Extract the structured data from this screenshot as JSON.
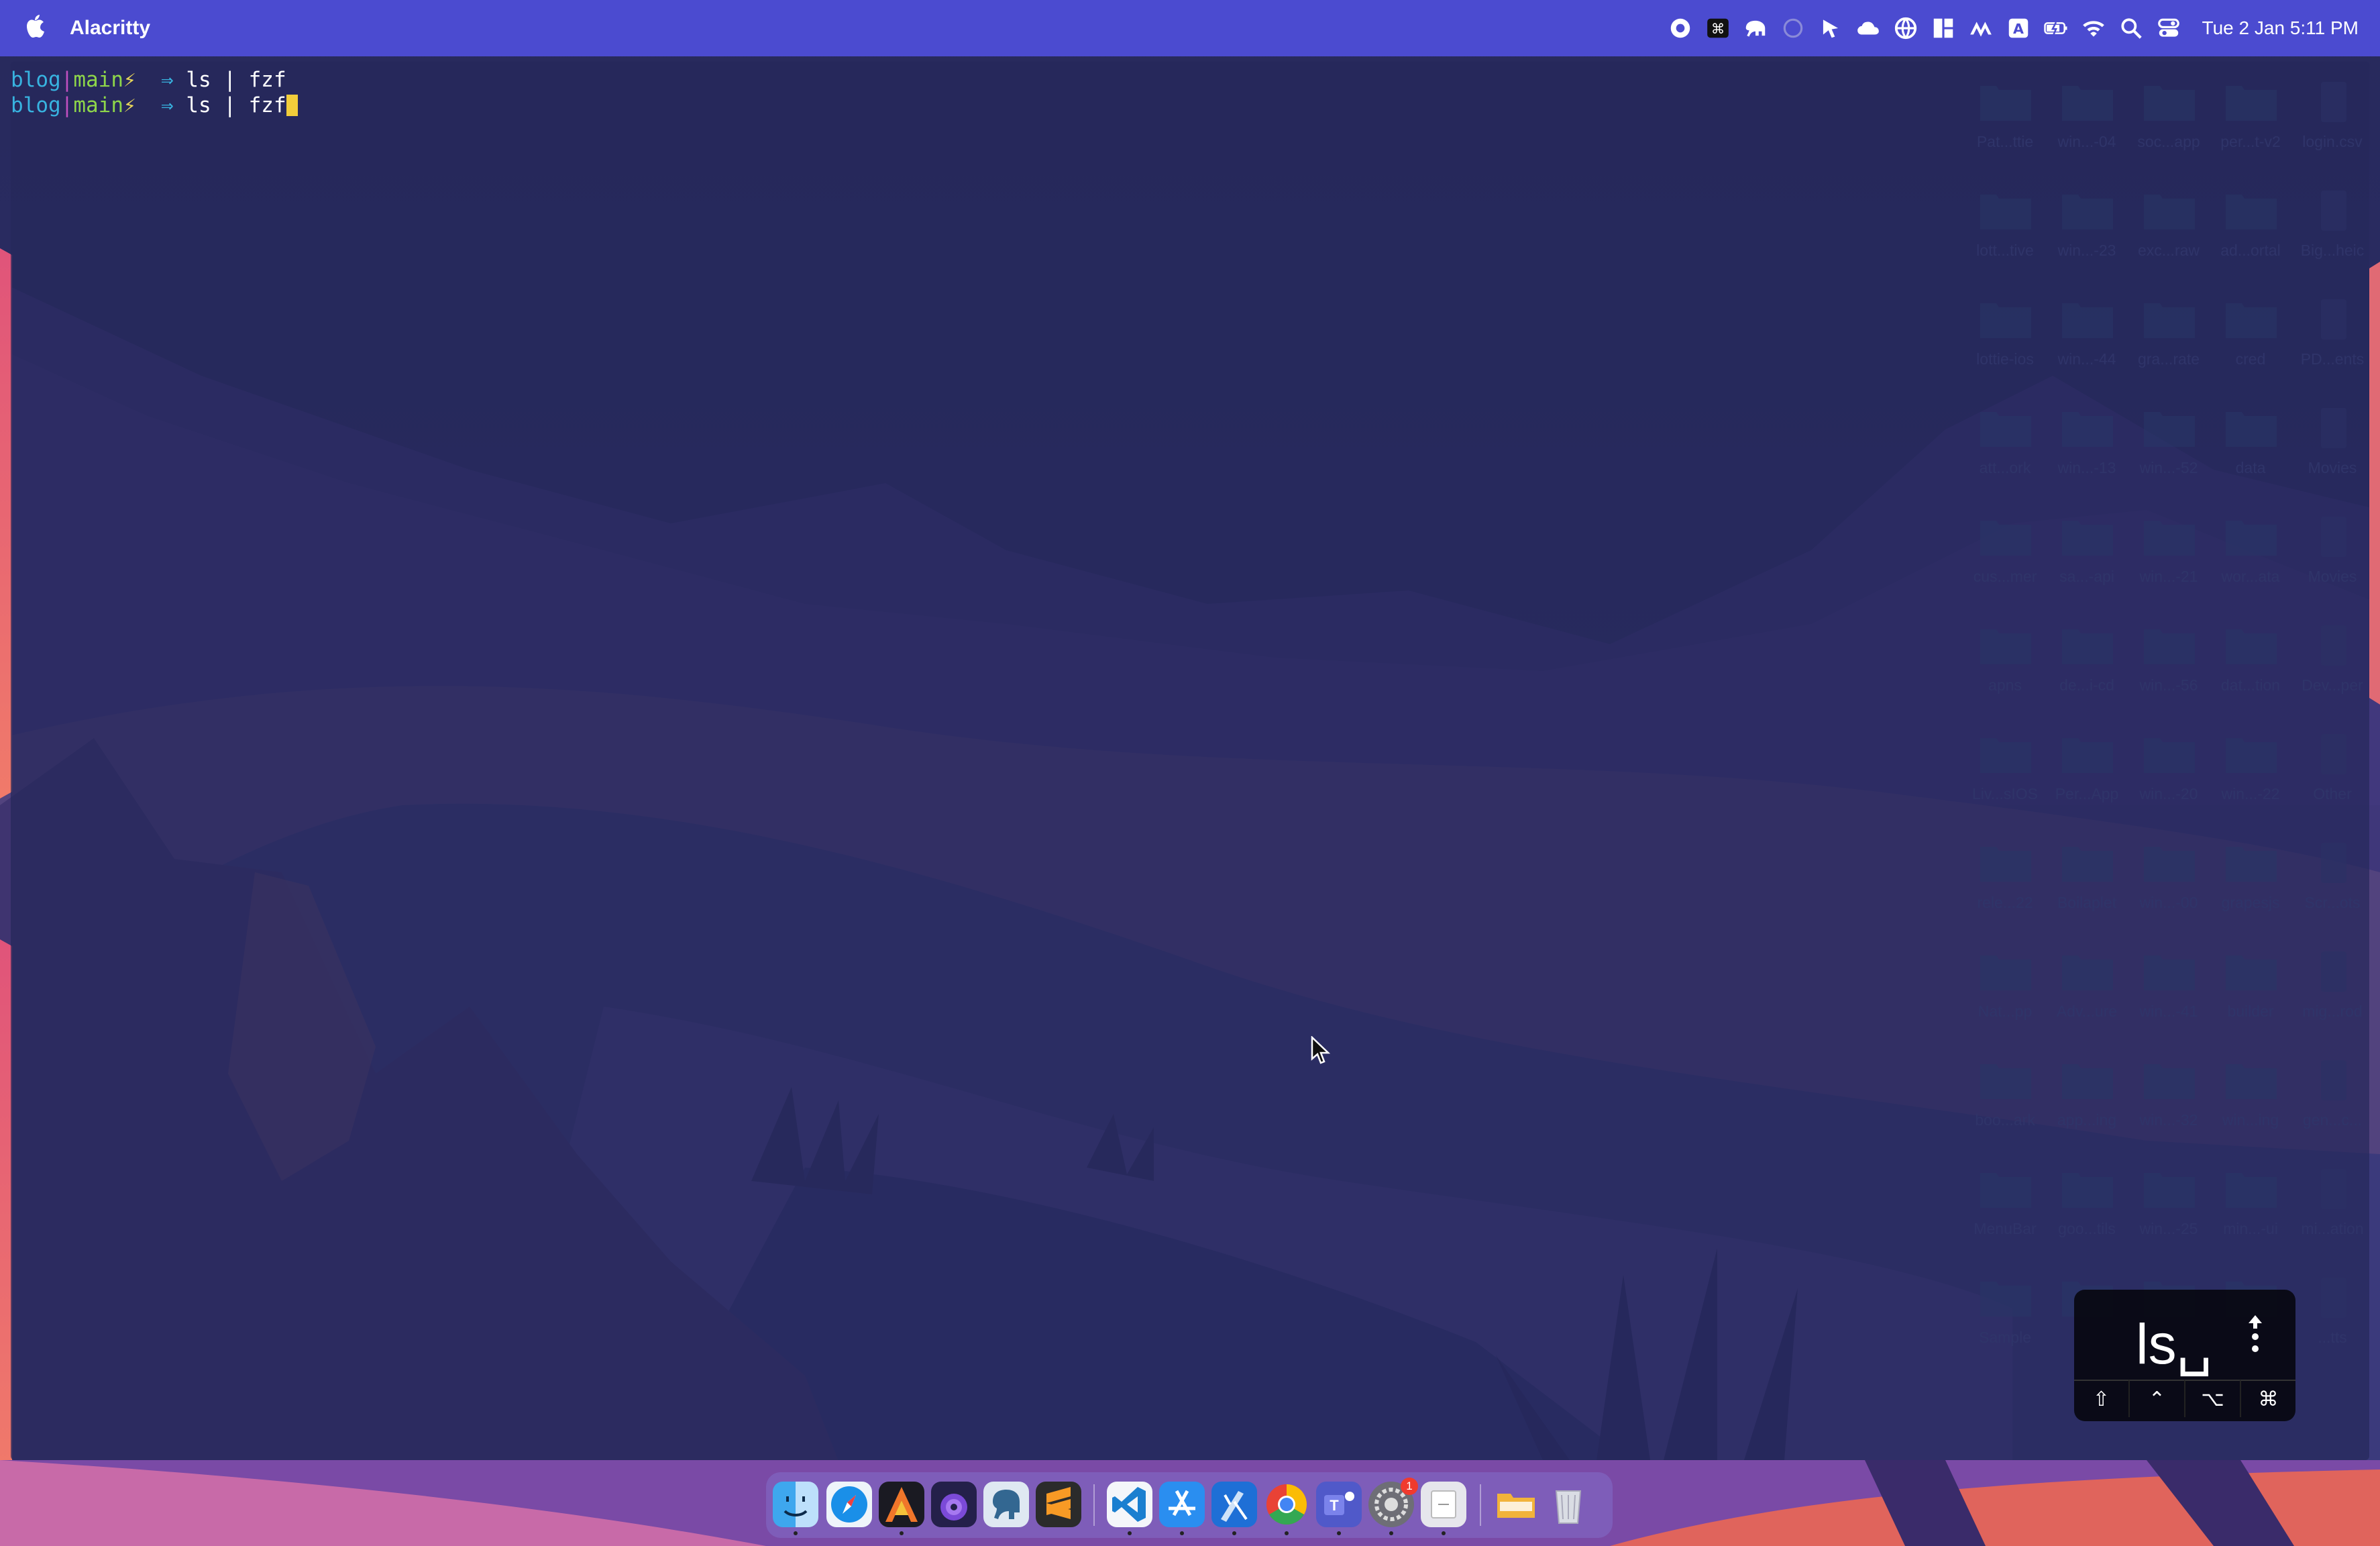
{
  "menubar": {
    "app_name": "Alacritty",
    "status_icons": [
      "record-icon",
      "command-key-icon",
      "elephant-icon",
      "circle-app-icon",
      "cursor-app-icon",
      "cloud-icon",
      "globe-icon",
      "windows-layout-icon",
      "raycast-icon",
      "input-source-icon",
      "battery-charging-icon",
      "wifi-icon",
      "search-icon",
      "control-center-icon"
    ],
    "input_source": "A",
    "clock": "Tue 2 Jan  5:11 PM"
  },
  "terminal": {
    "lines": [
      {
        "dir": "blog",
        "branch": "main",
        "bolt": "⚡",
        "arrow": "⇒",
        "cmd": "ls | fzf"
      },
      {
        "dir": "blog",
        "branch": "main",
        "bolt": "⚡",
        "arrow": "⇒",
        "cmd": "ls | fzf"
      }
    ]
  },
  "desktop": {
    "icons": [
      [
        "Pat...ttie",
        "win...-04",
        "soc...app",
        "per...t-v2",
        "login.csv"
      ],
      [
        "lott...tive",
        "win...-23",
        "exc...raw",
        "ad...ortal",
        "Big...heic"
      ],
      [
        "lottie-ios",
        "win...-44",
        "gra...rate",
        "cred",
        "PD...ents"
      ],
      [
        "att...ork",
        "win...-13",
        "win...-52",
        "data",
        "Movies"
      ],
      [
        "cus...mer",
        "sa...-api",
        "win...-21",
        "wor...ata",
        "Movies"
      ],
      [
        "apns",
        "de...i-cd",
        "win...-56",
        "dat...tion",
        "Dev...per"
      ],
      [
        "Liv...sIOS",
        "Per...App",
        "win...-20",
        "win...-22",
        "Other"
      ],
      [
        "rele...22",
        "Boilaplet",
        "win...-00",
        "grapesjs",
        "Scr...ots"
      ],
      [
        "Nat...pp",
        "Adv...ure",
        "win...-41",
        "builder",
        "mig...rod"
      ],
      [
        "boo...ark",
        "app...ing",
        "win...-32",
        "win...ing",
        "gen...c..."
      ],
      [
        "MenuBar",
        "goo...tils",
        "win...-25",
        "min...-ui",
        "mi...ation"
      ],
      [
        "Sample",
        "",
        "",
        "",
        "...tts"
      ]
    ]
  },
  "keycast": {
    "text": "ls␣",
    "modifiers": [
      "⇧",
      "⌃",
      "⌥",
      "⌘"
    ]
  },
  "dock": {
    "apps": [
      "finder-icon",
      "safari-icon",
      "alacritty-icon",
      "tor-browser-icon",
      "postgres-elephant-icon",
      "sublime-text-icon",
      "vscode-icon",
      "app-store-icon",
      "xcode-icon",
      "chrome-icon",
      "teams-icon",
      "system-settings-icon",
      "preview-icon",
      "folder-icon",
      "trash-icon"
    ],
    "settings_badge": "1"
  },
  "colors": {
    "menubar": "#4b4bd0",
    "terminal_dir": "#38b3e0",
    "terminal_branch": "#8ed64a",
    "cursor": "#f2cd3b"
  }
}
